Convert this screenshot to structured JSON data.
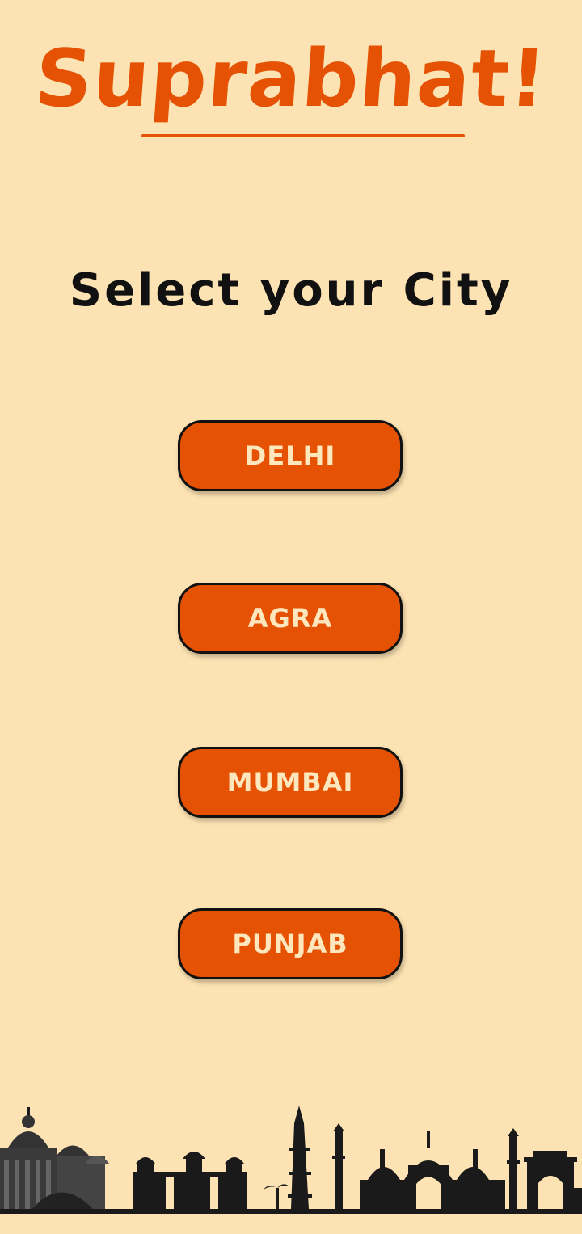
{
  "app": {
    "title": "Suprabhat!"
  },
  "prompt": "Select your City",
  "cities": [
    {
      "label": "DELHI"
    },
    {
      "label": "AGRA"
    },
    {
      "label": "MUMBAI"
    },
    {
      "label": "PUNJAB"
    }
  ],
  "colors": {
    "background": "#fde3b3",
    "accent": "#e55203",
    "button_text": "#ffe7bd",
    "text": "#111111"
  },
  "footer": {
    "image": "indian-monuments-skyline-illustration"
  }
}
